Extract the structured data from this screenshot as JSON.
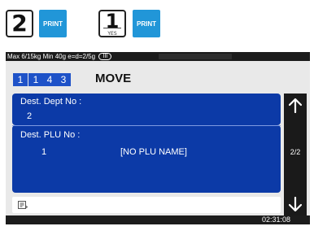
{
  "legend": {
    "key1_number": "2",
    "key1_button": "PRINT",
    "key2_number": "1",
    "key2_sub": "YES",
    "key2_button": "PRINT"
  },
  "status": {
    "scale_info": "Max 6/15kg Min 40g e=d=2/5g",
    "battery_label": "III"
  },
  "header": {
    "codes": [
      "1",
      "1",
      "4",
      "3"
    ],
    "title": "MOVE"
  },
  "fields": {
    "dept_label": "Dest. Dept No  :",
    "dept_value": "2",
    "plu_label": "Dest. PLU No   :",
    "plu_value": "1",
    "plu_name": "[NO PLU NAME]"
  },
  "pager": {
    "page": "2/2"
  },
  "footer": {
    "time": "02:31:08"
  },
  "colors": {
    "panel": "#0c3aa7",
    "code_box": "#1e52c8",
    "print_button": "#2196d8"
  }
}
